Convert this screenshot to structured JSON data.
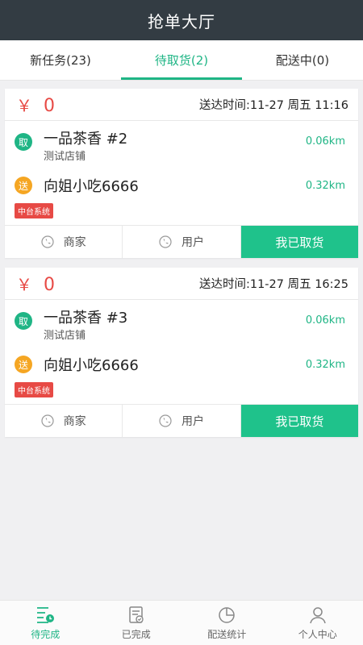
{
  "header": {
    "title": "抢单大厅"
  },
  "tabs": [
    {
      "label": "新任务(23)",
      "active": false
    },
    {
      "label": "待取货(2)",
      "active": true
    },
    {
      "label": "配送中(0)",
      "active": false
    }
  ],
  "orders": [
    {
      "currency": "￥",
      "price": "0",
      "deliver_time": "送达时间:11-27 周五 11:16",
      "pickup_badge": "取",
      "pickup_name": "一品茶香  #2",
      "pickup_sub": "测试店铺",
      "pickup_dist": "0.06km",
      "drop_badge": "送",
      "drop_name": "向姐小吃6666",
      "drop_dist": "0.32km",
      "tag": "中台系统",
      "actions": {
        "merchant": "商家",
        "user": "用户",
        "confirm": "我已取货"
      }
    },
    {
      "currency": "￥",
      "price": "0",
      "deliver_time": "送达时间:11-27 周五 16:25",
      "pickup_badge": "取",
      "pickup_name": "一品茶香  #3",
      "pickup_sub": "测试店铺",
      "pickup_dist": "0.06km",
      "drop_badge": "送",
      "drop_name": "向姐小吃6666",
      "drop_dist": "0.32km",
      "tag": "中台系统",
      "actions": {
        "merchant": "商家",
        "user": "用户",
        "confirm": "我已取货"
      }
    }
  ],
  "bottom_nav": [
    {
      "label": "待完成",
      "icon": "pending-list-icon",
      "active": true
    },
    {
      "label": "已完成",
      "icon": "completed-doc-icon",
      "active": false
    },
    {
      "label": "配送统计",
      "icon": "pie-chart-icon",
      "active": false
    },
    {
      "label": "个人中心",
      "icon": "person-icon",
      "active": false
    }
  ],
  "colors": {
    "accent": "#1fb585",
    "header_bg": "#333c43",
    "price": "#e74a45",
    "badge_orange": "#f5a623"
  }
}
